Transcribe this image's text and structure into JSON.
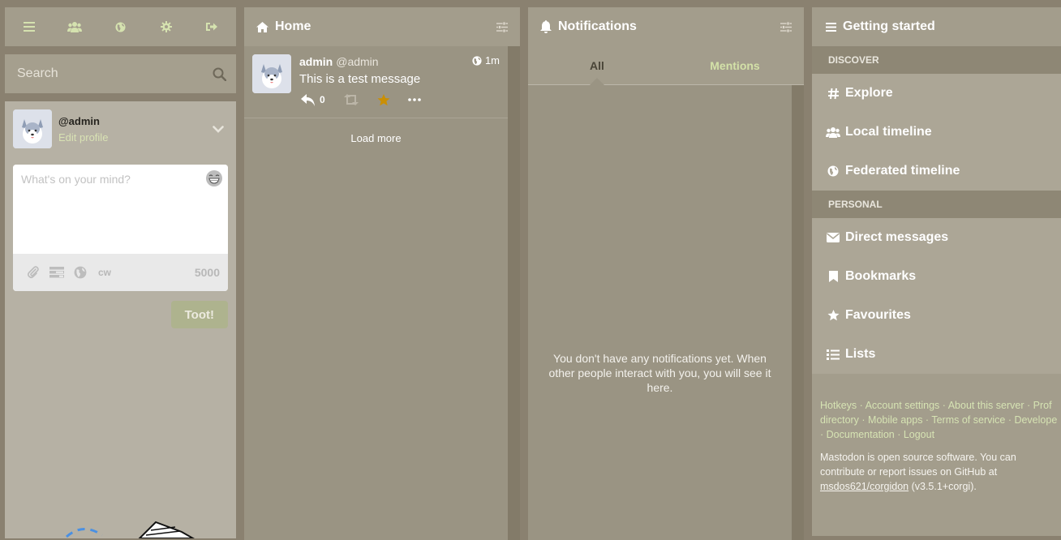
{
  "drawer": {
    "header_icons": [
      "hamburger-icon",
      "users-icon",
      "globe-icon",
      "gear-icon",
      "sign-out-icon"
    ],
    "search": {
      "placeholder": "Search"
    },
    "account": {
      "handle": "@admin",
      "edit_label": "Edit profile"
    },
    "compose": {
      "placeholder": "What's on your mind?",
      "cw_label": "cw",
      "char_count": "5000",
      "submit_label": "Toot!"
    }
  },
  "home": {
    "title": "Home",
    "status": {
      "display_name": "admin",
      "acct": "@admin",
      "time": "1m",
      "content": "This is a test message",
      "reply_count": "0",
      "favourited": true
    },
    "load_more": "Load more"
  },
  "notifications": {
    "title": "Notifications",
    "tabs": [
      "All",
      "Mentions"
    ],
    "active_tab": "All",
    "empty_message": "You don't have any notifications yet. When other people interact with you, you will see it here."
  },
  "getting_started": {
    "title": "Getting started",
    "sections": [
      {
        "heading": "DISCOVER",
        "items": [
          "Explore",
          "Local timeline",
          "Federated timeline"
        ]
      },
      {
        "heading": "PERSONAL",
        "items": [
          "Direct messages",
          "Bookmarks",
          "Favourites",
          "Lists"
        ]
      }
    ],
    "footer_links": {
      "hotkeys": "Hotkeys",
      "account_settings": "Account settings",
      "about": "About this server",
      "profile_directory_a": "Prof",
      "profile_directory_b": "directory",
      "mobile_apps": "Mobile apps",
      "terms": "Terms of service",
      "developers": "Develope",
      "documentation": "Documentation",
      "logout": "Logout"
    },
    "info_text": "Mastodon is open source software. You can contribute or report issues on GitHub at",
    "repo": "msdos621/corgidon",
    "version": "(v3.5.1+corgi)."
  },
  "colors": {
    "accent_green": "#d6e3b3",
    "favourite_orange": "#ca8f04",
    "column_bg": "#9a9483",
    "header_bg": "#a39d8c"
  }
}
